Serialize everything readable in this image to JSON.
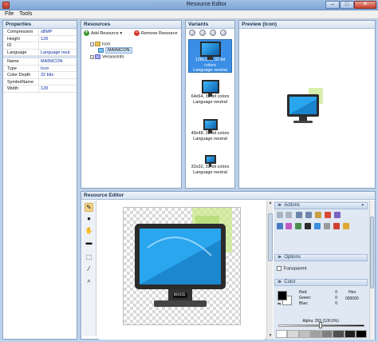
{
  "window": {
    "title": "Resource Editor",
    "minimize_glyph": "–",
    "maximize_glyph": "□",
    "close_glyph": "✕",
    "app_icon": "app-icon"
  },
  "menu": {
    "file": "File",
    "tools": "Tools"
  },
  "properties": {
    "header": "Properties",
    "rows": [
      {
        "key": "Compression",
        "value": "sBMP"
      },
      {
        "key": "Height",
        "value": "128"
      },
      {
        "key": "ID",
        "value": ""
      },
      {
        "key": "Language",
        "value": "Language neut"
      },
      {
        "key": "Name",
        "value": "MAINICON"
      },
      {
        "key": "Type",
        "value": "Icon"
      },
      {
        "key": "Color Depth",
        "value": "32 bits"
      },
      {
        "key": "SymbolName",
        "value": ""
      },
      {
        "key": "Width",
        "value": "128"
      }
    ]
  },
  "resources": {
    "header": "Resources",
    "add_label": "Add Resource",
    "remove_label": "Remove Resource",
    "tree": [
      {
        "label": "Icon",
        "expand": "−"
      },
      {
        "label": "MAINICON"
      },
      {
        "label": "VersionInfo",
        "expand": "+"
      }
    ]
  },
  "variants": {
    "header": "Variants",
    "items": [
      {
        "line1": "128x128, 32 bit colors",
        "line2": "Language neutral",
        "selected": true
      },
      {
        "line1": "64x64, 32 bit colors",
        "line2": "Language neutral",
        "selected": false
      },
      {
        "line1": "48x48, 32 bit colors",
        "line2": "Language neutral",
        "selected": false
      },
      {
        "line1": "32x32, 32 bit colors",
        "line2": "Language neutral",
        "selected": false
      }
    ]
  },
  "preview": {
    "header": "Preview (Icon)"
  },
  "editor": {
    "header": "Resource Editor",
    "tools": [
      "pencil-icon",
      "ellipse-icon",
      "hand-icon",
      "eraser-icon",
      "select-rect-icon",
      "eyedropper-icon",
      "zoom-icon"
    ],
    "screen_label": "DEVICE",
    "scroll_up": "▲",
    "scroll_down": "▼"
  },
  "actions_panel": {
    "header": "Actions",
    "pin": "✦",
    "chevron": "≫"
  },
  "options_panel": {
    "header": "Options",
    "transparent_label": "Transparent"
  },
  "color_panel": {
    "header": "Color",
    "red_label": "Red:",
    "red": "0",
    "green_label": "Green:",
    "green": "0",
    "blue_label": "Blue:",
    "blue": "0",
    "hex_label": "Hex:",
    "hex": "000000",
    "alpha_text": "Alpha: 255 (100.0%)",
    "palette": [
      "#ffffff",
      "#d8d8d8",
      "#c0c0c0",
      "#a0a0a0",
      "#808080",
      "#505050",
      "#202020",
      "#000000"
    ]
  },
  "colors": {
    "selection": "#3a8ee6",
    "panel_border": "#8aa3c4",
    "title_gradient_top": "#9fbfe3"
  }
}
